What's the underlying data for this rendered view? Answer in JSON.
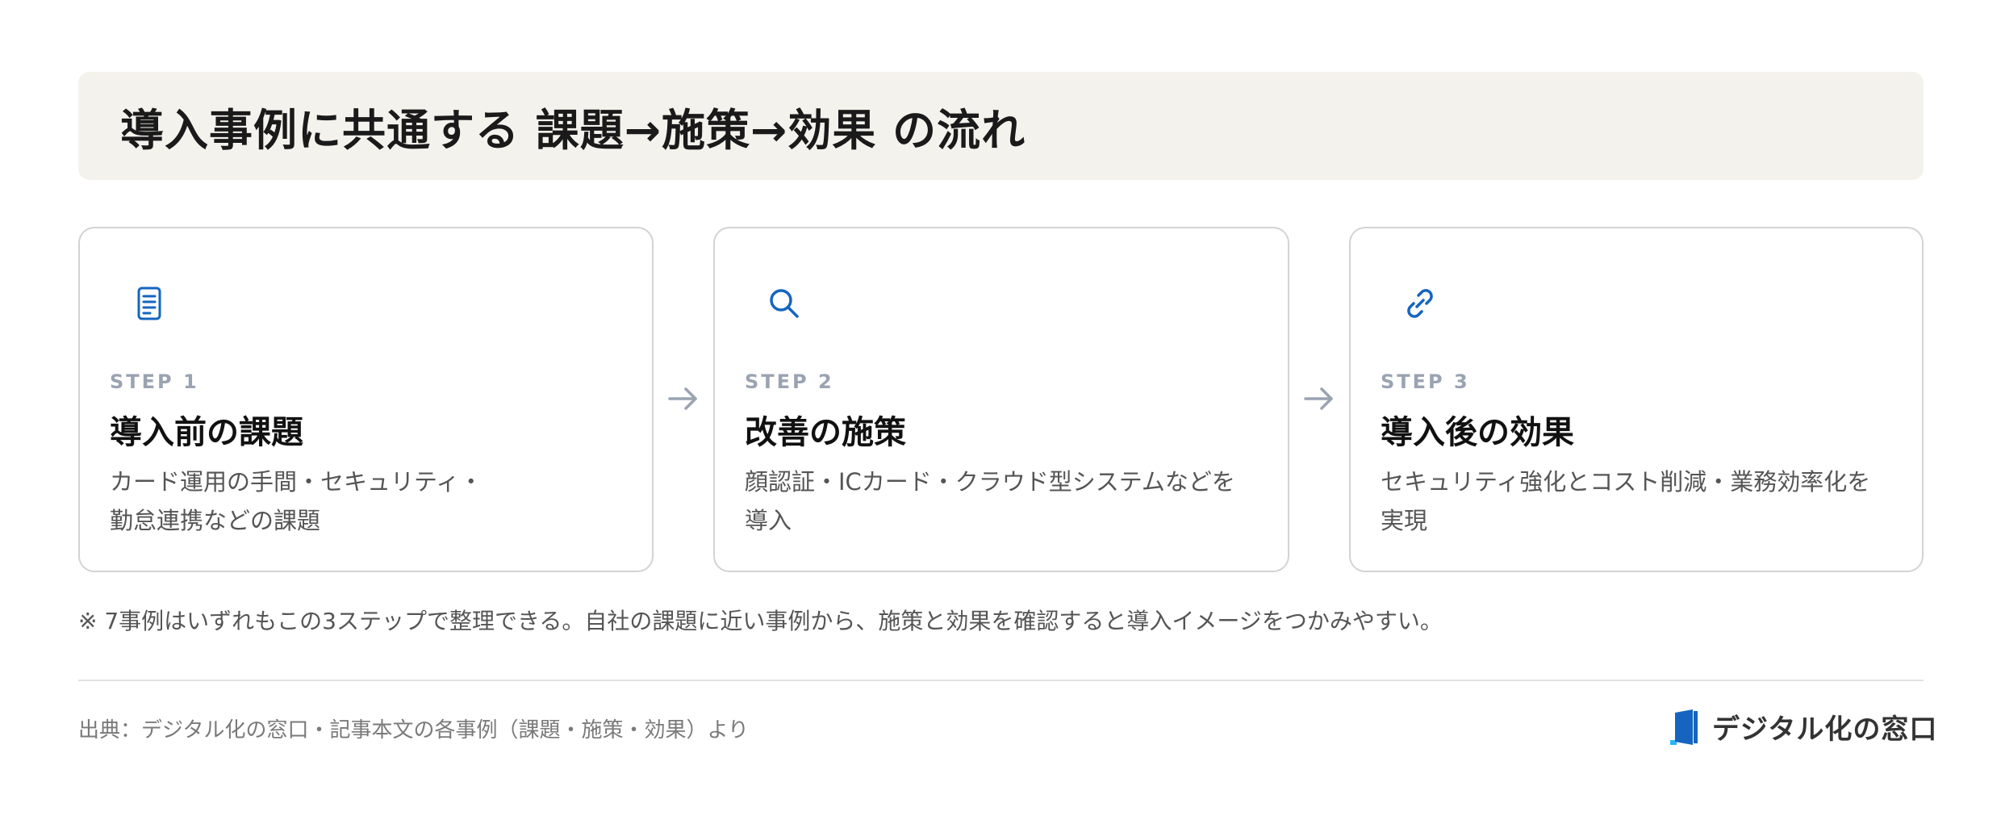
{
  "title": "導入事例に共通する 課題→施策→効果 の流れ",
  "steps": [
    {
      "icon": "document-icon",
      "step_label": "STEP 1",
      "title": "導入前の課題",
      "desc_lines": [
        "カード運用の手間・セキュリティ・",
        "勤怠連携などの課題"
      ]
    },
    {
      "icon": "search-icon",
      "step_label": "STEP 2",
      "title": "改善の施策",
      "desc_lines": [
        "顔認証・ICカード・クラウド型システムなどを",
        "導入"
      ]
    },
    {
      "icon": "link-icon",
      "step_label": "STEP 3",
      "title": "導入後の効果",
      "desc_lines": [
        "セキュリティ強化とコスト削減・業務効率化を",
        "実現"
      ]
    }
  ],
  "arrows": [
    "arrow-right-icon",
    "arrow-right-icon"
  ],
  "note": "※ 7事例はいずれもこの3ステップで整理できる。自社の課題に近い事例から、施策と効果を確認すると導入イメージをつかみやすい。",
  "source": "出典：デジタル化の窓口・記事本文の各事例（課題・施策・効果）より",
  "brand": {
    "logo": "door-logo-icon",
    "name": "デジタル化の窓口"
  },
  "colors": {
    "accent_blue": "#1565c0",
    "title_bg": "#f4f2ec",
    "step_label": "#9aa3b2",
    "arrow": "#9aa3b2"
  }
}
